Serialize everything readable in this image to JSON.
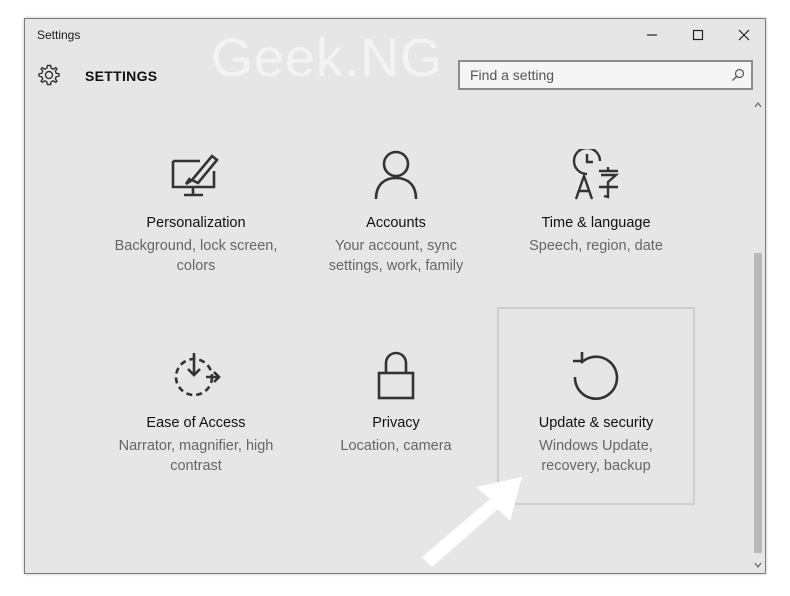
{
  "window": {
    "title": "Settings"
  },
  "watermark": "Geek.NG",
  "header": {
    "title": "SETTINGS"
  },
  "search": {
    "placeholder": "Find a setting",
    "value": ""
  },
  "tiles": [
    {
      "label": "Personalization",
      "desc": "Background, lock screen, colors",
      "icon": "personalization-icon"
    },
    {
      "label": "Accounts",
      "desc": "Your account, sync settings, work, family",
      "icon": "accounts-icon"
    },
    {
      "label": "Time & language",
      "desc": "Speech, region, date",
      "icon": "time-language-icon"
    },
    {
      "label": "Ease of Access",
      "desc": "Narrator, magnifier, high contrast",
      "icon": "ease-of-access-icon"
    },
    {
      "label": "Privacy",
      "desc": "Location, camera",
      "icon": "privacy-icon"
    },
    {
      "label": "Update & security",
      "desc": "Windows Update, recovery, backup",
      "icon": "update-security-icon",
      "selected": true
    }
  ],
  "colors": {
    "window_bg": "#e6e6e6",
    "text": "#111111",
    "desc_text": "#666666",
    "icon_stroke": "#333333"
  }
}
